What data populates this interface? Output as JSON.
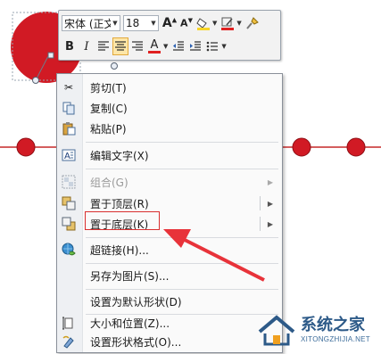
{
  "mini_toolbar": {
    "font_name": "宋体 (正文",
    "font_size": "18",
    "bold": "B",
    "italic": "I",
    "font_color_letter": "A",
    "grow_font": "A",
    "shrink_font": "A"
  },
  "context_menu": {
    "items": [
      {
        "label": "剪切(T)",
        "icon": "scissors-icon",
        "enabled": true,
        "submenu": false
      },
      {
        "label": "复制(C)",
        "icon": "copy-icon",
        "enabled": true,
        "submenu": false
      },
      {
        "label": "粘贴(P)",
        "icon": "paste-icon",
        "enabled": true,
        "submenu": false
      },
      {
        "label": "编辑文字(X)",
        "icon": "edit-text-icon",
        "enabled": true,
        "submenu": false
      },
      {
        "label": "组合(G)",
        "icon": "group-icon",
        "enabled": false,
        "submenu": true
      },
      {
        "label": "置于顶层(R)",
        "icon": "bring-to-front-icon",
        "enabled": true,
        "submenu": true
      },
      {
        "label": "置于底层(K)",
        "icon": "send-to-back-icon",
        "enabled": true,
        "submenu": true
      },
      {
        "label": "超链接(H)...",
        "icon": "hyperlink-icon",
        "enabled": true,
        "submenu": false
      },
      {
        "label": "另存为图片(S)...",
        "icon": "",
        "enabled": true,
        "submenu": false
      },
      {
        "label": "设置为默认形状(D)",
        "icon": "",
        "enabled": true,
        "submenu": false
      },
      {
        "label": "大小和位置(Z)...",
        "icon": "size-position-icon",
        "enabled": true,
        "submenu": false
      },
      {
        "label": "设置形状格式(O)...",
        "icon": "format-shape-icon",
        "enabled": true,
        "submenu": false
      }
    ]
  },
  "highlighted_item": "置于底层(K)",
  "watermark": {
    "name": "系统之家",
    "url": "XITONGZHIJIA.NET"
  },
  "colors": {
    "shape_red": "#d11a24",
    "highlight_red": "#e8333a",
    "font_color_bar": "#e02020",
    "highlight_yellow": "#f7d528",
    "watermark_blue": "#2d5a88"
  }
}
